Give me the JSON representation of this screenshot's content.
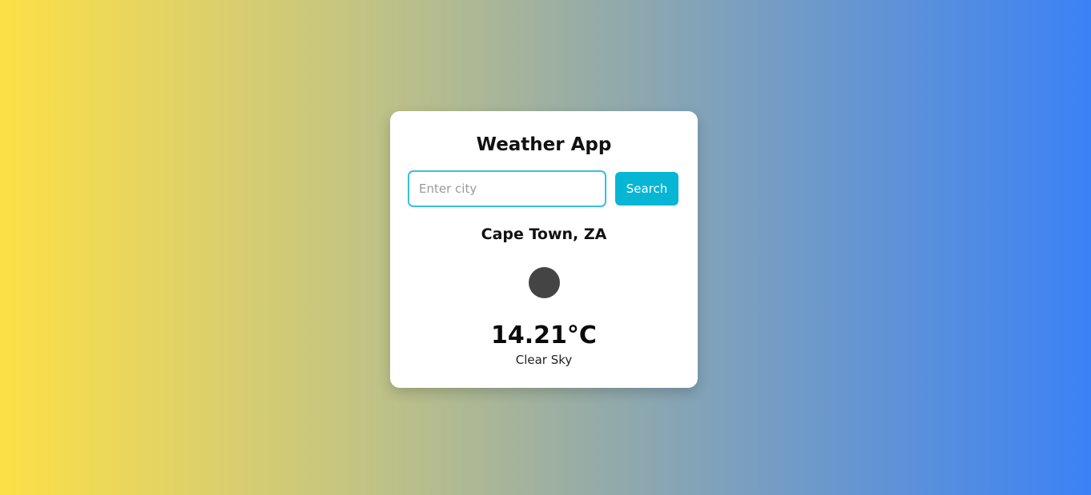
{
  "app": {
    "title": "Weather App"
  },
  "search": {
    "placeholder": "Enter city",
    "value": "",
    "button_label": "Search"
  },
  "weather": {
    "location": "Cape Town, ZA",
    "icon": "weather-icon",
    "temperature": "14.21°C",
    "description": "Clear Sky"
  },
  "colors": {
    "gradient_start": "#fde047",
    "gradient_end": "#3b82f6",
    "accent": "#06b6d4",
    "input_border": "#38c0dc",
    "card_background": "#ffffff"
  }
}
